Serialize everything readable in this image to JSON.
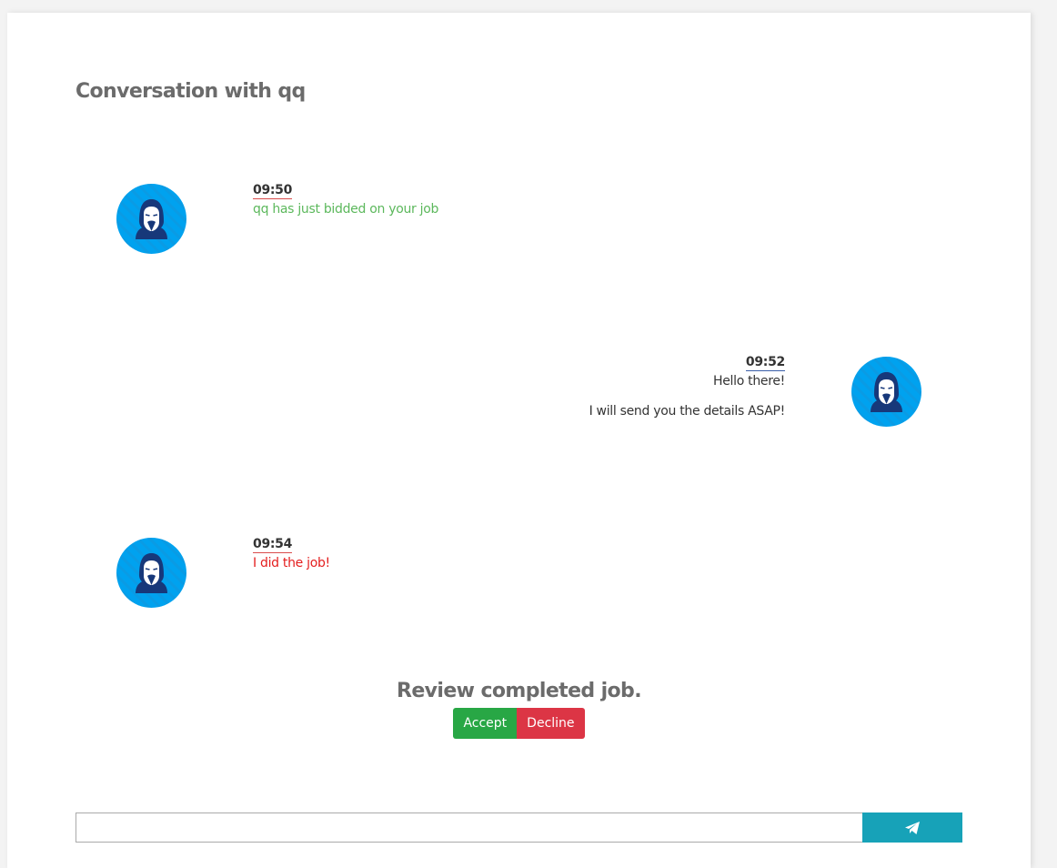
{
  "page": {
    "title": "Conversation with qq"
  },
  "messages": [
    {
      "side": "left",
      "time": "09:50",
      "lines": [
        "qq has just bidded on your job"
      ],
      "color": "#5cb85c"
    },
    {
      "side": "right",
      "time": "09:52",
      "lines": [
        "Hello there!",
        "I will send you the details ASAP!"
      ],
      "color": "#333333"
    },
    {
      "side": "left",
      "time": "09:54",
      "lines": [
        "I did the job!"
      ],
      "color": "#e41e1e"
    }
  ],
  "review": {
    "heading": "Review completed job.",
    "accept_label": "Accept",
    "decline_label": "Decline",
    "accept_color": "#28a745",
    "decline_color": "#dc3545"
  },
  "composer": {
    "value": "",
    "placeholder": "",
    "send_icon": "paper-plane-icon",
    "send_color": "#17a2b8"
  },
  "avatar": {
    "icon": "anonymous-mask-icon",
    "background": "#00a2ef"
  }
}
